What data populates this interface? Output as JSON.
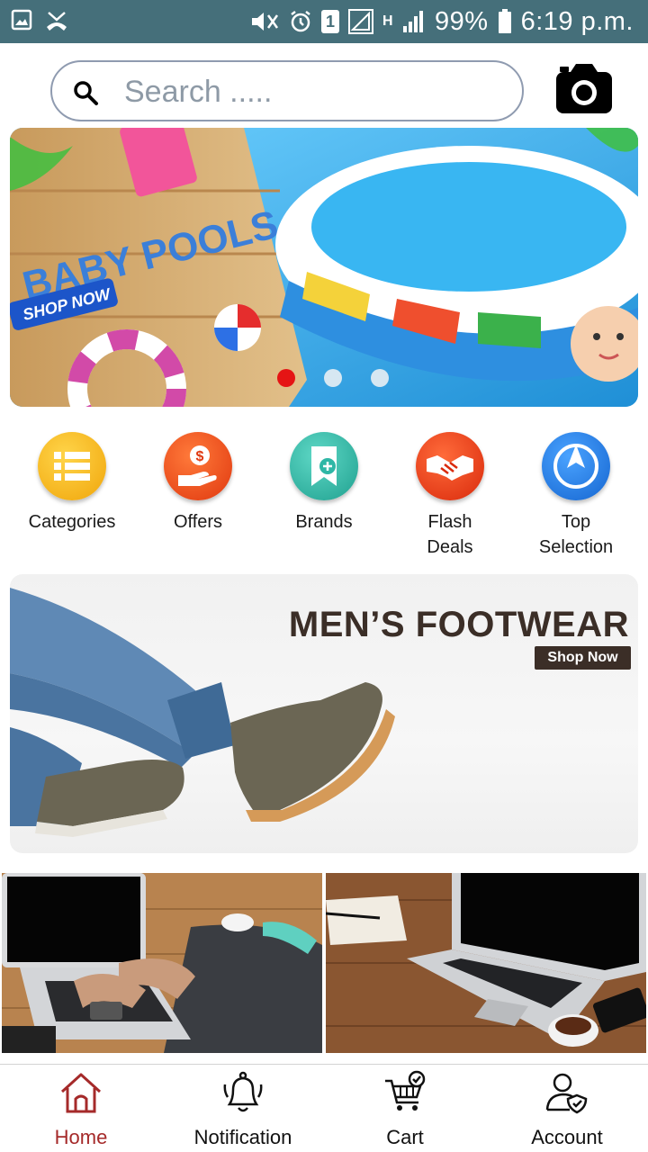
{
  "status_bar": {
    "battery_percent": "99%",
    "time": "6:19 p.m.",
    "sim_slot": "1",
    "network_type": "H",
    "icons": [
      "gallery-icon",
      "missed-call-icon",
      "mute-icon",
      "alarm-icon",
      "sim-icon",
      "signal-icon",
      "battery-icon"
    ]
  },
  "search": {
    "placeholder": "Search .....",
    "value": "",
    "icon": "search-icon",
    "camera_icon": "camera-icon"
  },
  "hero_banner": {
    "title_text": "BABY POOLS",
    "cta_text": "SHOP NOW",
    "slide_count": 3,
    "active_slide": 1
  },
  "quick_links": [
    {
      "label": "Categories",
      "icon": "list-icon",
      "color": "#f5b21a"
    },
    {
      "label": "Offers",
      "icon": "dollar-hand-icon",
      "color": "#ee4a1c"
    },
    {
      "label": "Brands",
      "icon": "bookmark-plus-icon",
      "color": "#2fb7a6"
    },
    {
      "label_line1": "Flash",
      "label_line2": "Deals",
      "icon": "handshake-icon",
      "color": "#f2421a"
    },
    {
      "label_line1": "Top",
      "label_line2": "Selection",
      "icon": "compass-icon",
      "color": "#1f7de0"
    }
  ],
  "promo_banner": {
    "title": "MEN’S FOOTWEAR",
    "cta": "Shop Now"
  },
  "product_tiles": [
    {
      "image": "laptop-typing-photo"
    },
    {
      "image": "laptop-on-desk-photo"
    }
  ],
  "bottom_nav": {
    "items": [
      {
        "label": "Home",
        "icon": "home-icon",
        "active": true
      },
      {
        "label": "Notification",
        "icon": "bell-icon",
        "active": false
      },
      {
        "label": "Cart",
        "icon": "cart-icon",
        "active": false
      },
      {
        "label": "Account",
        "icon": "account-icon",
        "active": false
      }
    ],
    "active_color": "#a52a2a"
  },
  "colors": {
    "status_bar": "#456f7a",
    "search_border": "#8f9bb0",
    "active_dot": "#e51414",
    "promo_text": "#3b2e27"
  }
}
